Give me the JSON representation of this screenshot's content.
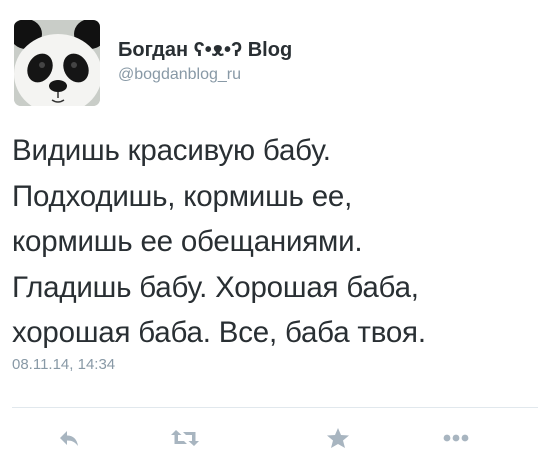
{
  "author": {
    "display_name": "Богдан ʕ•ᴥ•ʔ Blog",
    "handle": "@bogdanblog_ru",
    "avatar_icon": "panda-avatar"
  },
  "tweet": {
    "lines": [
      "Видишь красивую бабу.",
      "Подходишь, кормишь ее,",
      "кормишь ее обещаниями.",
      "Гладишь бабу. Хорошая баба,",
      "хорошая баба. Все, баба твоя."
    ],
    "timestamp": "08.11.14, 14:34"
  },
  "actions": {
    "reply_icon": "reply-icon",
    "retweet_icon": "retweet-icon",
    "favorite_icon": "star-icon",
    "more_icon": "more-icon",
    "icon_color": "#a8b5c0"
  },
  "colors": {
    "text": "#292f33",
    "secondary": "#8899a6",
    "divider": "#e1e8ed"
  }
}
